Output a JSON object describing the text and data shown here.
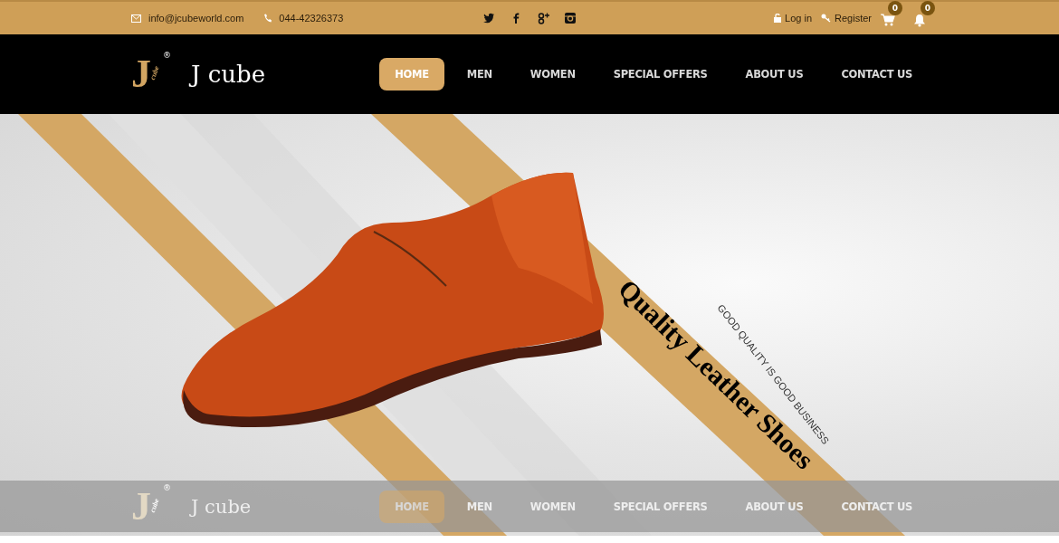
{
  "top_bar": {
    "email": "info@jcubeworld.com",
    "phone": "044-42326373",
    "login": "Log in",
    "register": "Register",
    "cart_count": "0",
    "notification_count": "0"
  },
  "header": {
    "logo": {
      "mark": "J",
      "mark_sub": "cube",
      "registered": "®",
      "name": "J cube"
    },
    "menu": [
      {
        "label": "HOME",
        "selected": true
      },
      {
        "label": "MEN",
        "selected": false
      },
      {
        "label": "WOMEN",
        "selected": false
      },
      {
        "label": "SPECIAL OFFERS",
        "selected": false
      },
      {
        "label": "ABOUT US",
        "selected": false
      },
      {
        "label": "CONTACT US",
        "selected": false
      }
    ]
  },
  "hero": {
    "title": "Quality Leather Shoes",
    "subtitle": "GOOD QUALITY IS GOOD BUSINESS"
  },
  "sticky_header": {
    "logo": {
      "mark": "J",
      "mark_sub": "cube",
      "registered": "®",
      "name": "J cube"
    },
    "menu": [
      {
        "label": "HOME",
        "selected": true
      },
      {
        "label": "MEN",
        "selected": false
      },
      {
        "label": "WOMEN",
        "selected": false
      },
      {
        "label": "SPECIAL OFFERS",
        "selected": false
      },
      {
        "label": "ABOUT US",
        "selected": false
      },
      {
        "label": "CONTACT US",
        "selected": false
      }
    ]
  }
}
